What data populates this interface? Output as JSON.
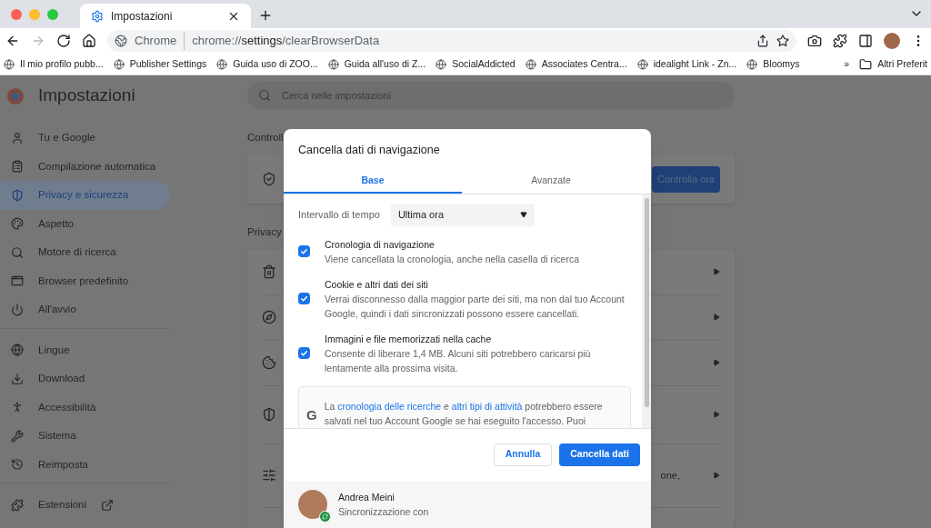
{
  "browser": {
    "tabs": [
      {
        "title": "Impostazioni",
        "selected": true
      }
    ],
    "omnibox": {
      "site": "Chrome",
      "url_prefix": "chrome://",
      "url_bold": "settings",
      "url_suffix": "/clearBrowserData"
    },
    "bookmarks": [
      {
        "label": "Il mio profilo pubb..."
      },
      {
        "label": "Publisher Settings"
      },
      {
        "label": "Guida uso di ZOO..."
      },
      {
        "label": "Guida all'uso di Z..."
      },
      {
        "label": "SocialAddicted"
      },
      {
        "label": "Associates Centra..."
      },
      {
        "label": "idealight Link - Zn..."
      },
      {
        "label": "Bloomys"
      }
    ],
    "bookmarks_more": "»",
    "other_bookmarks": "Altri Preferit"
  },
  "settings": {
    "title": "Impostazioni",
    "search_placeholder": "Cerca nelle impostazioni",
    "sidebar": [
      [
        {
          "label": "Tu e Google",
          "selected": false
        },
        {
          "label": "Compilazione automatica",
          "selected": false
        },
        {
          "label": "Privacy e sicurezza",
          "selected": true
        },
        {
          "label": "Aspetto",
          "selected": false
        },
        {
          "label": "Motore di ricerca",
          "selected": false
        },
        {
          "label": "Browser predefinito",
          "selected": false
        },
        {
          "label": "All'avvio",
          "selected": false
        }
      ],
      [
        {
          "label": "Lingue",
          "selected": false
        },
        {
          "label": "Download",
          "selected": false
        },
        {
          "label": "Accessibilità",
          "selected": false
        },
        {
          "label": "Sistema",
          "selected": false
        },
        {
          "label": "Reimposta",
          "selected": false
        }
      ],
      [
        {
          "label": "Estensioni",
          "selected": false
        }
      ]
    ],
    "sections": [
      {
        "heading": "Controll",
        "button": "Controlla ora"
      },
      {
        "heading": "Privacy",
        "row_tail": "one,"
      }
    ]
  },
  "dialog": {
    "title": "Cancella dati di navigazione",
    "tabs": [
      {
        "label": "Base",
        "selected": true
      },
      {
        "label": "Avanzate",
        "selected": false
      }
    ],
    "time_range": {
      "label": "Intervallo di tempo",
      "value": "Ultima ora"
    },
    "options": [
      {
        "title": "Cronologia di navigazione",
        "description": "Viene cancellata la cronologia, anche nella casella di ricerca",
        "checked": true
      },
      {
        "title": "Cookie e altri dati dei siti",
        "description": "Verrai disconnesso dalla maggior parte dei siti, ma non dal tuo Account Google, quindi i dati sincronizzati possono essere cancellati.",
        "checked": true
      },
      {
        "title": "Immagini e file memorizzati nella cache",
        "description": "Consente di liberare 1,4 MB. Alcuni siti potrebbero caricarsi più lentamente alla prossima visita.",
        "checked": true
      }
    ],
    "notice": {
      "logo": "G",
      "before": "La ",
      "link1": "cronologia delle ricerche",
      "middle": " e ",
      "link2": "altri tipi di attività",
      "after": " potrebbero essere salvati nel tuo Account Google se hai eseguito l'accesso. Puoi"
    },
    "buttons": [
      {
        "label": "Annulla",
        "kind": "secondary"
      },
      {
        "label": "Cancella dati",
        "kind": "primary"
      }
    ],
    "account": {
      "name": "Andrea Meini",
      "status": "Sincronizzazione con"
    }
  }
}
